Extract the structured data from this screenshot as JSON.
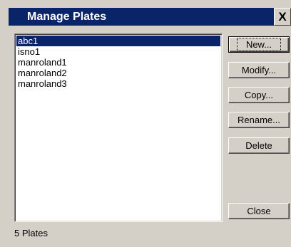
{
  "window": {
    "title": "Manage Plates",
    "close_glyph": "X",
    "close_icon": "close-icon"
  },
  "plates": {
    "items": [
      "abc1",
      "isno1",
      "manroland1",
      "manroland2",
      "manroland3"
    ],
    "selected": "abc1"
  },
  "buttons": {
    "new": "New...",
    "modify": "Modify...",
    "copy": "Copy...",
    "rename": "Rename...",
    "delete": "Delete",
    "close": "Close"
  },
  "status": {
    "count_text": "5 Plates"
  },
  "colors": {
    "titlebar": "#0a246a",
    "selection": "#0a246a",
    "dialog_bg": "#d4d0c8"
  }
}
